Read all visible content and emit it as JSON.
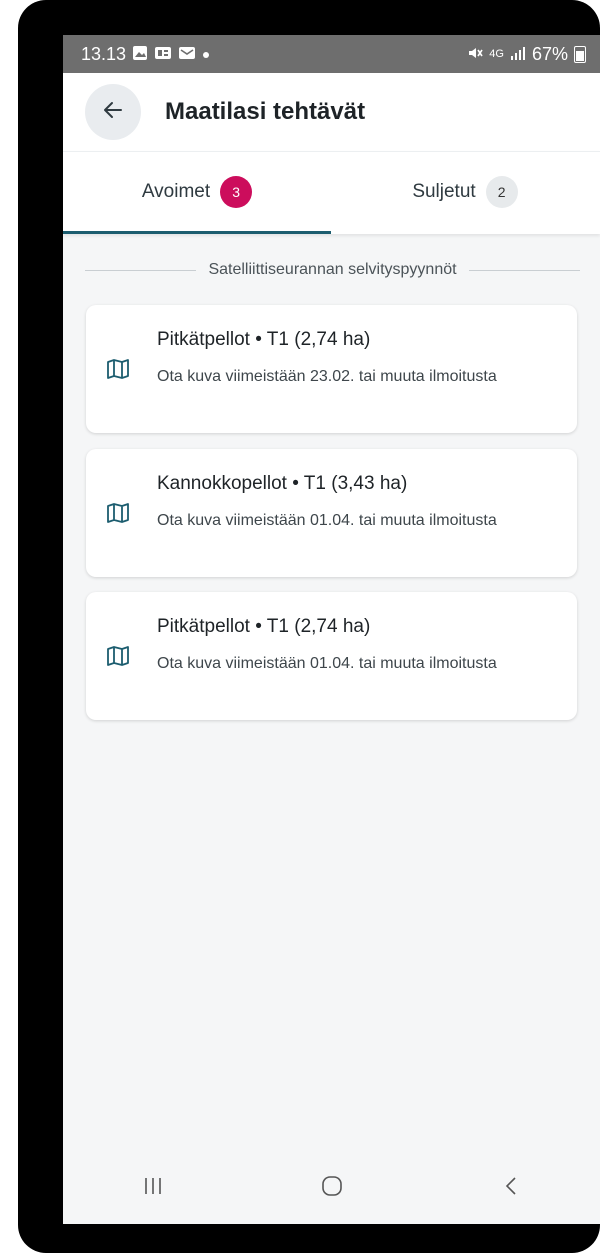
{
  "status_bar": {
    "time": "13.13",
    "battery": "67%",
    "signal": "4G"
  },
  "app_bar": {
    "title": "Maatilasi tehtävät",
    "back_icon": "arrow-left-icon"
  },
  "tabs": [
    {
      "label": "Avoimet",
      "count": "3",
      "active": true
    },
    {
      "label": "Suljetut",
      "count": "2",
      "active": false
    }
  ],
  "section": {
    "title": "Satelliittiseurannan selvityspyynnöt"
  },
  "tasks": [
    {
      "title": "Pitkätpellot • T1 (2,74 ha)",
      "description": "Ota kuva viimeistään 23.02. tai muuta ilmoitusta",
      "icon": "map-icon"
    },
    {
      "title": "Kannokkopellot • T1 (3,43 ha)",
      "description": "Ota kuva viimeistään 01.04. tai muuta ilmoitusta",
      "icon": "map-icon"
    },
    {
      "title": "Pitkätpellot • T1 (2,74 ha)",
      "description": "Ota kuva viimeistään 01.04. tai muuta ilmoitusta",
      "icon": "map-icon"
    }
  ],
  "colors": {
    "accent": "#1c5d6f",
    "badge_active": "#cc0d5c",
    "badge_idle": "#e7eaec"
  },
  "nav_bar": {
    "buttons": [
      "recent-apps-icon",
      "home-icon",
      "back-icon"
    ]
  }
}
